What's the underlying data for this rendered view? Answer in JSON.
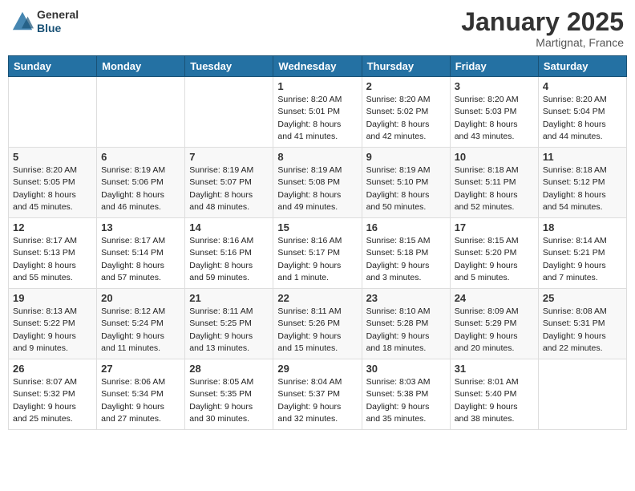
{
  "header": {
    "logo_general": "General",
    "logo_blue": "Blue",
    "month_title": "January 2025",
    "location": "Martignat, France"
  },
  "weekdays": [
    "Sunday",
    "Monday",
    "Tuesday",
    "Wednesday",
    "Thursday",
    "Friday",
    "Saturday"
  ],
  "weeks": [
    [
      {
        "day": "",
        "info": ""
      },
      {
        "day": "",
        "info": ""
      },
      {
        "day": "",
        "info": ""
      },
      {
        "day": "1",
        "info": "Sunrise: 8:20 AM\nSunset: 5:01 PM\nDaylight: 8 hours\nand 41 minutes."
      },
      {
        "day": "2",
        "info": "Sunrise: 8:20 AM\nSunset: 5:02 PM\nDaylight: 8 hours\nand 42 minutes."
      },
      {
        "day": "3",
        "info": "Sunrise: 8:20 AM\nSunset: 5:03 PM\nDaylight: 8 hours\nand 43 minutes."
      },
      {
        "day": "4",
        "info": "Sunrise: 8:20 AM\nSunset: 5:04 PM\nDaylight: 8 hours\nand 44 minutes."
      }
    ],
    [
      {
        "day": "5",
        "info": "Sunrise: 8:20 AM\nSunset: 5:05 PM\nDaylight: 8 hours\nand 45 minutes."
      },
      {
        "day": "6",
        "info": "Sunrise: 8:19 AM\nSunset: 5:06 PM\nDaylight: 8 hours\nand 46 minutes."
      },
      {
        "day": "7",
        "info": "Sunrise: 8:19 AM\nSunset: 5:07 PM\nDaylight: 8 hours\nand 48 minutes."
      },
      {
        "day": "8",
        "info": "Sunrise: 8:19 AM\nSunset: 5:08 PM\nDaylight: 8 hours\nand 49 minutes."
      },
      {
        "day": "9",
        "info": "Sunrise: 8:19 AM\nSunset: 5:10 PM\nDaylight: 8 hours\nand 50 minutes."
      },
      {
        "day": "10",
        "info": "Sunrise: 8:18 AM\nSunset: 5:11 PM\nDaylight: 8 hours\nand 52 minutes."
      },
      {
        "day": "11",
        "info": "Sunrise: 8:18 AM\nSunset: 5:12 PM\nDaylight: 8 hours\nand 54 minutes."
      }
    ],
    [
      {
        "day": "12",
        "info": "Sunrise: 8:17 AM\nSunset: 5:13 PM\nDaylight: 8 hours\nand 55 minutes."
      },
      {
        "day": "13",
        "info": "Sunrise: 8:17 AM\nSunset: 5:14 PM\nDaylight: 8 hours\nand 57 minutes."
      },
      {
        "day": "14",
        "info": "Sunrise: 8:16 AM\nSunset: 5:16 PM\nDaylight: 8 hours\nand 59 minutes."
      },
      {
        "day": "15",
        "info": "Sunrise: 8:16 AM\nSunset: 5:17 PM\nDaylight: 9 hours\nand 1 minute."
      },
      {
        "day": "16",
        "info": "Sunrise: 8:15 AM\nSunset: 5:18 PM\nDaylight: 9 hours\nand 3 minutes."
      },
      {
        "day": "17",
        "info": "Sunrise: 8:15 AM\nSunset: 5:20 PM\nDaylight: 9 hours\nand 5 minutes."
      },
      {
        "day": "18",
        "info": "Sunrise: 8:14 AM\nSunset: 5:21 PM\nDaylight: 9 hours\nand 7 minutes."
      }
    ],
    [
      {
        "day": "19",
        "info": "Sunrise: 8:13 AM\nSunset: 5:22 PM\nDaylight: 9 hours\nand 9 minutes."
      },
      {
        "day": "20",
        "info": "Sunrise: 8:12 AM\nSunset: 5:24 PM\nDaylight: 9 hours\nand 11 minutes."
      },
      {
        "day": "21",
        "info": "Sunrise: 8:11 AM\nSunset: 5:25 PM\nDaylight: 9 hours\nand 13 minutes."
      },
      {
        "day": "22",
        "info": "Sunrise: 8:11 AM\nSunset: 5:26 PM\nDaylight: 9 hours\nand 15 minutes."
      },
      {
        "day": "23",
        "info": "Sunrise: 8:10 AM\nSunset: 5:28 PM\nDaylight: 9 hours\nand 18 minutes."
      },
      {
        "day": "24",
        "info": "Sunrise: 8:09 AM\nSunset: 5:29 PM\nDaylight: 9 hours\nand 20 minutes."
      },
      {
        "day": "25",
        "info": "Sunrise: 8:08 AM\nSunset: 5:31 PM\nDaylight: 9 hours\nand 22 minutes."
      }
    ],
    [
      {
        "day": "26",
        "info": "Sunrise: 8:07 AM\nSunset: 5:32 PM\nDaylight: 9 hours\nand 25 minutes."
      },
      {
        "day": "27",
        "info": "Sunrise: 8:06 AM\nSunset: 5:34 PM\nDaylight: 9 hours\nand 27 minutes."
      },
      {
        "day": "28",
        "info": "Sunrise: 8:05 AM\nSunset: 5:35 PM\nDaylight: 9 hours\nand 30 minutes."
      },
      {
        "day": "29",
        "info": "Sunrise: 8:04 AM\nSunset: 5:37 PM\nDaylight: 9 hours\nand 32 minutes."
      },
      {
        "day": "30",
        "info": "Sunrise: 8:03 AM\nSunset: 5:38 PM\nDaylight: 9 hours\nand 35 minutes."
      },
      {
        "day": "31",
        "info": "Sunrise: 8:01 AM\nSunset: 5:40 PM\nDaylight: 9 hours\nand 38 minutes."
      },
      {
        "day": "",
        "info": ""
      }
    ]
  ]
}
